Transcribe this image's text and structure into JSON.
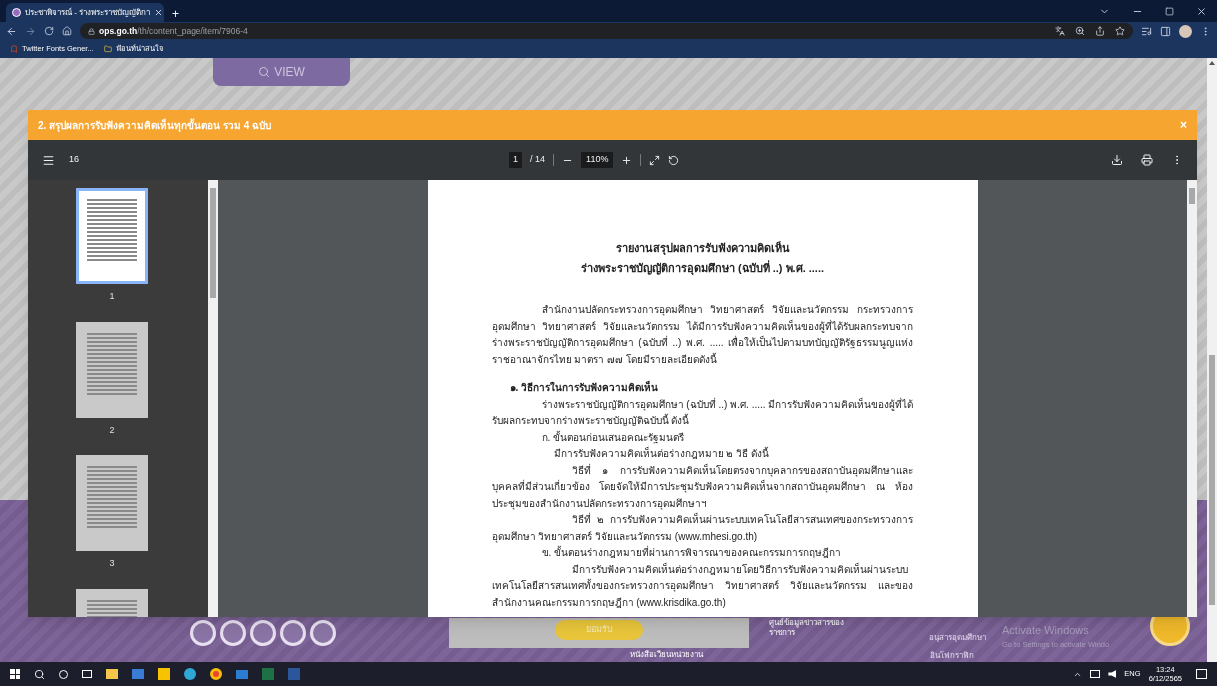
{
  "browser": {
    "tab_title": "ประชาพิจารณ์ - ร่างพระราชบัญญัติกา",
    "new_tab": "+",
    "url_domain": "ops.go.th",
    "url_path": "/th/content_page/item/7906-4",
    "bookmarks": [
      "Twitter Fonts Gener...",
      "ฟ้อนท์น่าสนใจ"
    ]
  },
  "page": {
    "view_button": "VIEW"
  },
  "modal": {
    "title": "2. สรุปผลการรับฟังความคิดเห็นทุกขั้นตอน รวม 4 ฉบับ",
    "close": "×"
  },
  "pdf_toolbar": {
    "title": "16",
    "page": "1",
    "page_total": "/ 14",
    "zoom": "110%"
  },
  "thumbnails": [
    {
      "label": "1",
      "selected": true
    },
    {
      "label": "2",
      "selected": false
    },
    {
      "label": "3",
      "selected": false
    },
    {
      "selected": false
    }
  ],
  "document": [
    {
      "kind": "title",
      "text": "รายงานสรุปผลการรับฟังความคิดเห็น"
    },
    {
      "kind": "title",
      "text": "ร่างพระราชบัญญัติการอุดมศึกษา (ฉบับที่ ..) พ.ศ. ....."
    },
    {
      "kind": "para",
      "text": "สำนักงานปลัดกระทรวงการอุดมศึกษา วิทยาศาสตร์ วิจัยและนวัตกรรม กระทรวงการอุดมศึกษา วิทยาศาสตร์ วิจัยและนวัตกรรม ได้มีการรับฟังความคิดเห็นของผู้ที่ได้รับผลกระทบจากร่างพระราชบัญญัติการอุดมศึกษา (ฉบับที่ ..) พ.ศ. .....  เพื่อให้เป็นไปตามบทบัญญัติรัฐธรรมนูญแห่งราชอาณาจักรไทย มาตรา ๗๗ โดยมีรายละเอียดดังนี้"
    },
    {
      "kind": "heading",
      "text": "๑. วิธีการในการรับฟังความคิดเห็น"
    },
    {
      "kind": "body",
      "text": "ร่างพระราชบัญญัติการอุดมศึกษา (ฉบับที่ ..) พ.ศ. ..... มีการรับฟังความคิดเห็นของผู้ที่ได้รับผลกระทบจากร่างพระราชบัญญัติฉบับนี้ ดังนี้"
    },
    {
      "kind": "step",
      "text": "ก. ขั้นตอนก่อนเสนอคณะรัฐมนตรี"
    },
    {
      "kind": "note",
      "text": "มีการรับฟังความคิดเห็นต่อร่างกฎหมาย ๒ วิธี ดังนี้"
    },
    {
      "kind": "method",
      "text": "วิธีที่ ๑ การรับฟังความคิดเห็นโดยตรงจากบุคลากรของสถาบันอุดมศึกษาและบุคคลที่มีส่วนเกี่ยวข้อง โดยจัดให้มีการประชุมรับฟังความคิดเห็นจากสถาบันอุดมศึกษา ณ ห้องประชุมของสำนักงานปลัดกระทรวงการอุดมศึกษาฯ"
    },
    {
      "kind": "method",
      "text": "วิธีที่ ๒ การรับฟังความคิดเห็นผ่านระบบเทคโนโลยีสารสนเทศของกระทรวงการอุดมศึกษา วิทยาศาสตร์ วิจัยและนวัตกรรม (www.mhesi.go.th)"
    },
    {
      "kind": "step",
      "text": "ข. ขั้นตอนร่างกฎหมายที่ผ่านการพิจารณาของคณะกรรมการกฤษฎีกา"
    },
    {
      "kind": "method",
      "text": "มีการรับฟังความคิดเห็นต่อร่างกฎหมายโดยวิธีการรับฟังความคิดเห็นผ่านระบบเทคโนโลยีสารสนเทศทั้งของกระทรวงการอุดมศึกษา วิทยาศาสตร์ วิจัยและนวัตกรรม และของสำนักงานคณะกรรมการกฤษฎีกา (www.krisdika.go.th)"
    }
  ],
  "footer": {
    "accept_button": "ยอมรับ",
    "links": [
      "ศูนย์ข้อมูลข่าวสารของราชการ",
      "อนุสารอุดมศึกษา",
      "หนังสือเวียนหน่วยงาน",
      "อินโฟกราฟิก"
    ]
  },
  "activation": {
    "title": "Activate Windows",
    "hint": "Go to Settings to activate Windo"
  },
  "taskbar": {
    "language": "ENG",
    "time": "13:24",
    "date": "6/12/2565"
  }
}
